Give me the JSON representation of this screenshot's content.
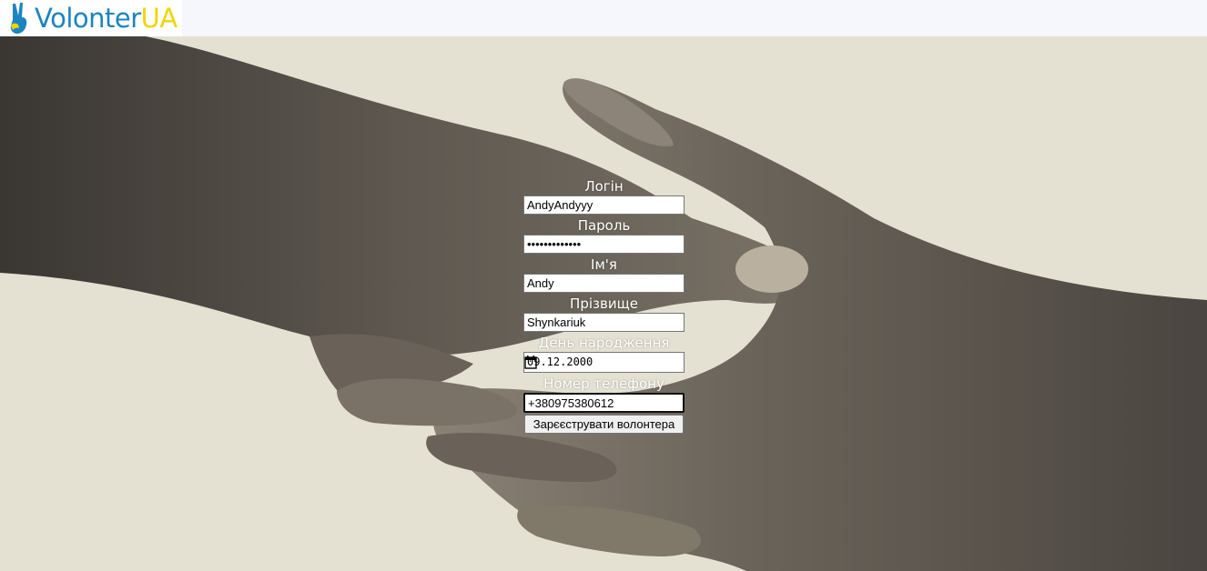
{
  "header": {
    "logo_main": "Volonter",
    "logo_accent": "UA"
  },
  "form": {
    "login_label": "Логін",
    "login_value": "AndyAndyyy",
    "password_label": "Пароль",
    "password_value": "•••••••••••••",
    "first_name_label": "Ім'я",
    "first_name_value": "Andy",
    "last_name_label": "Прізвище",
    "last_name_value": "Shynkariuk",
    "birthday_label": "День народження",
    "birthday_value": "09.12.2000",
    "phone_label": "Номер телефону",
    "phone_value": "+380975380612",
    "submit_label": "Зарєєструвати волонтера"
  },
  "colors": {
    "logo_blue": "#1b85bf",
    "logo_yellow": "#f3d500",
    "hero_background": "#e5e1d2"
  }
}
